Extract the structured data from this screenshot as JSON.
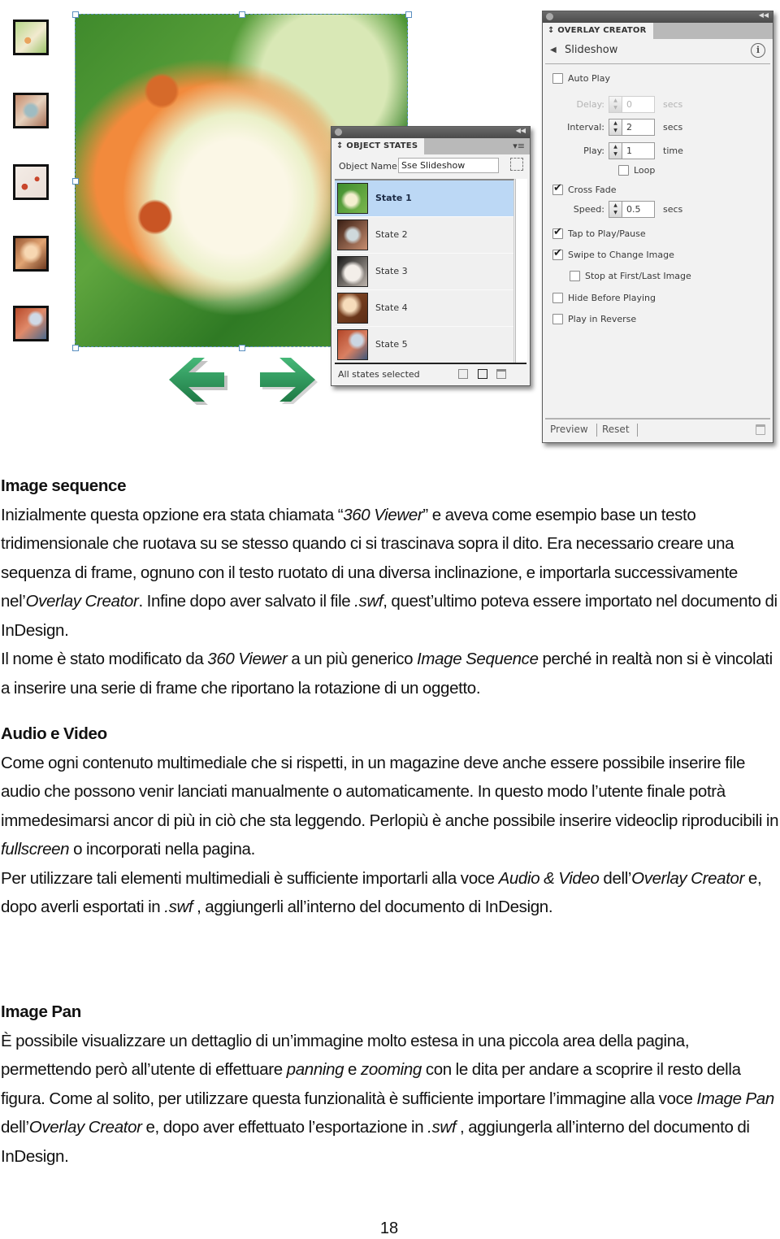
{
  "figure": {
    "thumbnails": [
      "thumbnail-1",
      "thumbnail-2",
      "thumbnail-3",
      "thumbnail-4",
      "thumbnail-5"
    ],
    "nav_arrows": {
      "left": "arrow-left-icon",
      "right": "arrow-right-icon",
      "color": "#2e9a5a"
    }
  },
  "overlay_creator": {
    "tab_label": "⬍ OVERLAY CREATOR",
    "header_title": "Slideshow",
    "back_icon": "◀",
    "info_icon": "i",
    "auto_play_label": "Auto Play",
    "auto_play_checked": false,
    "delay": {
      "label": "Delay:",
      "value": "0",
      "unit": "secs",
      "enabled": false
    },
    "interval": {
      "label": "Interval:",
      "value": "2",
      "unit": "secs"
    },
    "play": {
      "label": "Play:",
      "value": "1",
      "unit": "time"
    },
    "loop_label": "Loop",
    "loop_checked": false,
    "cross_fade_label": "Cross Fade",
    "cross_fade_checked": true,
    "speed": {
      "label": "Speed:",
      "value": "0.5",
      "unit": "secs"
    },
    "tap_label": "Tap to Play/Pause",
    "tap_checked": true,
    "swipe_label": "Swipe to Change Image",
    "swipe_checked": true,
    "stop_label": "Stop at First/Last Image",
    "stop_checked": false,
    "hide_label": "Hide Before Playing",
    "hide_checked": false,
    "reverse_label": "Play in Reverse",
    "reverse_checked": false,
    "preview_label": "Preview",
    "reset_label": "Reset"
  },
  "object_states": {
    "tab_label": "⬍ OBJECT STATES",
    "object_name_label": "Object Name:",
    "object_name_value": "Sse Slideshow",
    "states": [
      {
        "label": "State 1",
        "selected": true
      },
      {
        "label": "State 2",
        "selected": false
      },
      {
        "label": "State 3",
        "selected": false
      },
      {
        "label": "State 4",
        "selected": false
      },
      {
        "label": "State 5",
        "selected": false
      }
    ],
    "footer_label": "All states selected"
  },
  "sections": {
    "image_sequence": {
      "title": "Image sequence",
      "p1": [
        "Inizialmente questa opzione era stata chiamata “",
        "360 Viewer",
        "” e aveva come esempio base un testo tridimensionale che ruotava su se stesso quando ci si trascinava sopra il dito. Era necessario creare una sequenza di frame, ognuno con il testo ruotato di una diversa inclinazione, e importarla successivamente nel’",
        "Overlay Creator",
        ". Infine dopo aver salvato il file ",
        ".swf",
        ", quest’ultimo poteva essere importato nel documento di InDesign."
      ],
      "p2": [
        "Il nome è stato modificato da ",
        "360 Viewer",
        " a un più generico ",
        "Image Sequence",
        " perché in realtà non si è vincolati a inserire una serie di frame che riportano la rotazione di un oggetto."
      ]
    },
    "audio_video": {
      "title": "Audio e Video",
      "p1": [
        "Come ogni contenuto multimediale che si rispetti, in un magazine deve anche essere possibile inserire file audio che possono venir lanciati manualmente o automaticamente. In questo modo l’utente finale potrà immedesimarsi ancor di più in ciò che sta leggendo. Perlopiù è anche possibile inserire videoclip riproducibili in ",
        "fullscreen",
        " o incorporati nella pagina."
      ],
      "p2": [
        "Per utilizzare tali elementi multimediali è sufficiente importarli alla voce ",
        "Audio & Video",
        " dell’",
        "Overlay Creator",
        " e, dopo averli esportati in ",
        ".swf",
        " , aggiungerli all’interno del documento di InDesign."
      ]
    },
    "image_pan": {
      "title": "Image Pan",
      "p1": [
        "È possibile visualizzare un dettaglio di un’immagine molto estesa in una piccola area della pagina, permettendo però all’utente di effettuare ",
        "panning",
        " e ",
        "zooming",
        " con le dita per andare a scoprire il resto della figura. Come al solito, per utilizzare questa funzionalità è sufficiente importare l’immagine alla voce ",
        "Image Pan",
        " dell’",
        "Overlay Creator",
        " e, dopo aver effettuato l’esportazione in ",
        ".swf",
        " , aggiungerla all’interno del documento di InDesign."
      ]
    }
  },
  "page_number": "18"
}
